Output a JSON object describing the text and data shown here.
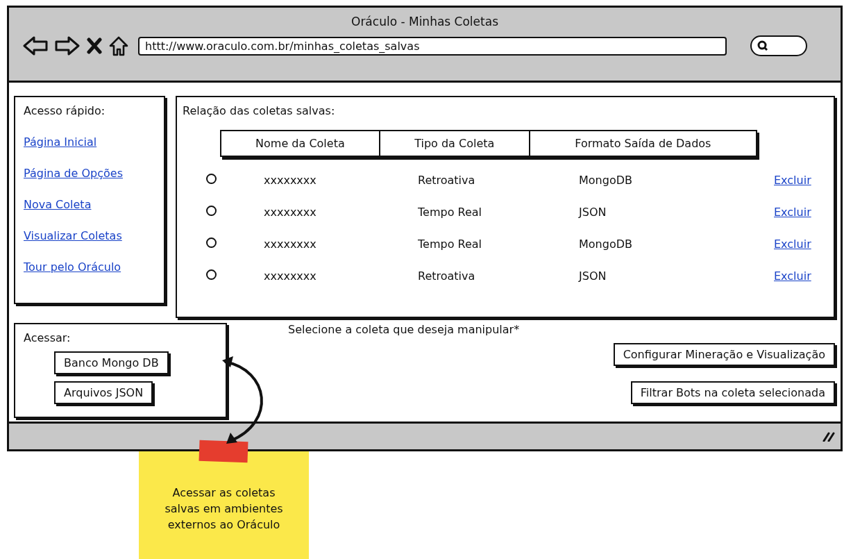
{
  "window": {
    "title": "Oráculo - Minhas Coletas",
    "address": "httt://www.oraculo.com.br/minhas_coletas_salvas"
  },
  "quick_access": {
    "title": "Acesso rápido:",
    "links": [
      "Página Inicial",
      "Página de Opções",
      "Nova Coleta",
      "Visualizar Coletas",
      "Tour pelo Oráculo"
    ]
  },
  "saved": {
    "title": "Relação das coletas salvas:",
    "columns": [
      "Nome da Coleta",
      "Tipo da Coleta",
      "Formato Saída de Dados"
    ],
    "rows": [
      {
        "selected": false,
        "name": "xxxxxxxx",
        "type": "Retroativa",
        "format": "MongoDB",
        "action": "Excluir"
      },
      {
        "selected": false,
        "name": "xxxxxxxx",
        "type": "Tempo Real",
        "format": "JSON",
        "action": "Excluir"
      },
      {
        "selected": false,
        "name": "xxxxxxxx",
        "type": "Tempo Real",
        "format": "MongoDB",
        "action": "Excluir"
      },
      {
        "selected": false,
        "name": "xxxxxxxx",
        "type": "Retroativa",
        "format": "JSON",
        "action": "Excluir"
      }
    ]
  },
  "hint": "Selecione a coleta que deseja manipular*",
  "actions": [
    "Configurar Mineração e Visualização",
    "Filtrar Bots na coleta selecionada"
  ],
  "access": {
    "title": "Acessar:",
    "buttons": [
      "Banco Mongo DB",
      "Arquivos JSON"
    ]
  },
  "note": {
    "text": "Acessar as coletas salvas em ambientes externos ao Oráculo"
  }
}
